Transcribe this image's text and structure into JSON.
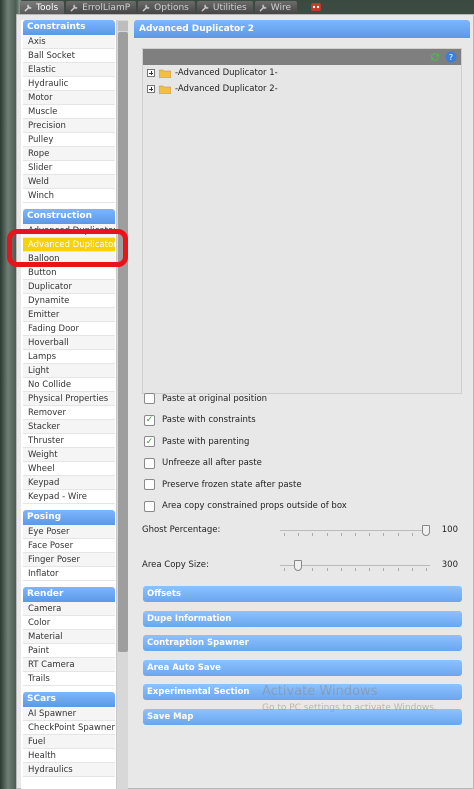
{
  "tabs": [
    {
      "label": "Tools",
      "active": true
    },
    {
      "label": "ErrolLiamP",
      "active": false
    },
    {
      "label": "Options",
      "active": false
    },
    {
      "label": "Utilities",
      "active": false
    },
    {
      "label": "Wire",
      "active": false
    }
  ],
  "categories": [
    {
      "title": "Constraints",
      "items": [
        "Axis",
        "Ball Socket",
        "Elastic",
        "Hydraulic",
        "Motor",
        "Muscle",
        "Precision",
        "Pulley",
        "Rope",
        "Slider",
        "Weld",
        "Winch"
      ]
    },
    {
      "title": "Construction",
      "items": [
        "Advanced Duplicator",
        "Advanced Duplicator ...",
        "Balloon",
        "Button",
        "Duplicator",
        "Dynamite",
        "Emitter",
        "Fading Door",
        "Hoverball",
        "Lamps",
        "Light",
        "No Collide",
        "Physical Properties",
        "Remover",
        "Stacker",
        "Thruster",
        "Weight",
        "Wheel",
        "Keypad",
        "Keypad - Wire"
      ]
    },
    {
      "title": "Posing",
      "items": [
        "Eye Poser",
        "Face Poser",
        "Finger Poser",
        "Inflator"
      ]
    },
    {
      "title": "Render",
      "items": [
        "Camera",
        "Color",
        "Material",
        "Paint",
        "RT Camera",
        "Trails"
      ]
    },
    {
      "title": "SCars",
      "items": [
        "AI Spawner",
        "CheckPoint Spawner",
        "Fuel",
        "Health",
        "Hydraulics"
      ]
    }
  ],
  "selected_item": "Advanced Duplicator ...",
  "panel": {
    "title": "Advanced Duplicator 2",
    "tree": [
      "-Advanced Duplicator 1-",
      "-Advanced Duplicator 2-"
    ],
    "options": [
      {
        "label": "Paste at original position",
        "checked": false
      },
      {
        "label": "Paste with constraints",
        "checked": true
      },
      {
        "label": "Paste with parenting",
        "checked": true
      },
      {
        "label": "Unfreeze all after paste",
        "checked": false
      },
      {
        "label": "Preserve frozen state after paste",
        "checked": false
      },
      {
        "label": "Area copy constrained props outside of box",
        "checked": false
      }
    ],
    "sliders": [
      {
        "label": "Ghost Percentage:",
        "value": "100",
        "fraction": 1.0
      },
      {
        "label": "Area Copy Size:",
        "value": "300",
        "fraction": 0.1
      }
    ],
    "sections": [
      "Offsets",
      "Dupe Information",
      "Contraption Spawner",
      "Area Auto Save",
      "Experimental Section",
      "Save Map"
    ]
  },
  "watermark": {
    "title": "Activate Windows",
    "subtitle": "Go to PC settings to activate Windows."
  },
  "colors": {
    "header_blue": "#5b98e6",
    "selected_yellow": "#f5d20a",
    "highlight_red": "#e8141c",
    "check_green": "#3a9a3a"
  },
  "icons": {
    "tab": "wrench-icon",
    "refresh": "refresh-icon",
    "help": "help-icon",
    "folder": "folder-icon",
    "record": "record-icon"
  }
}
